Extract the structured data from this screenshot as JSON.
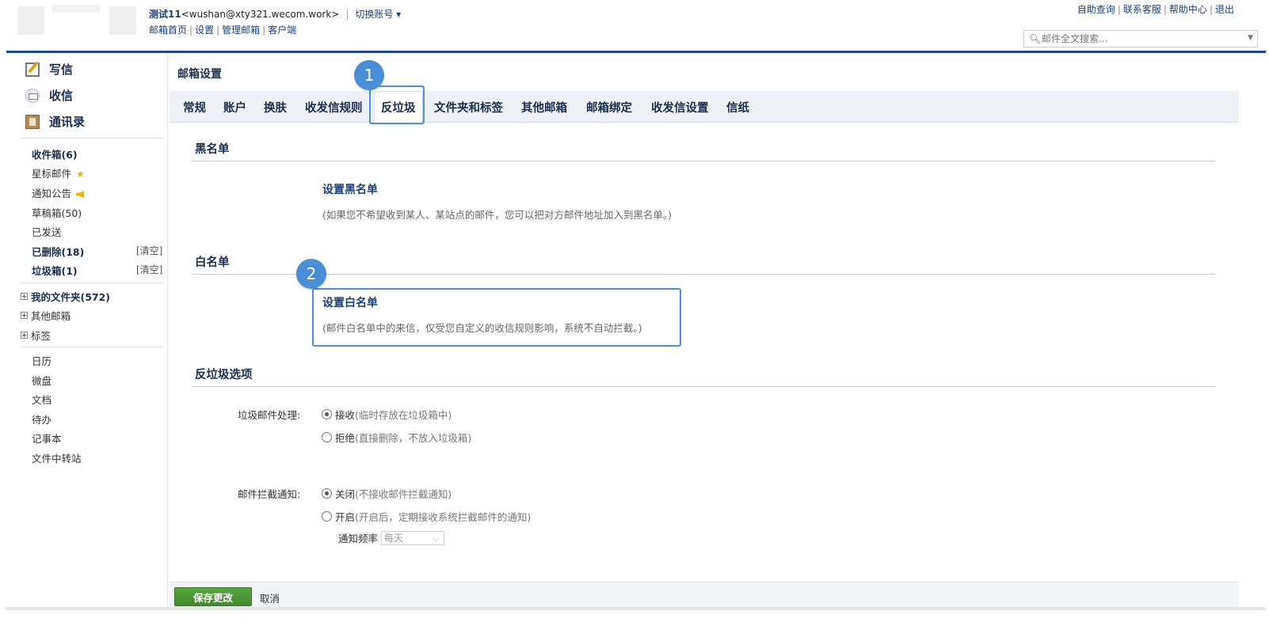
{
  "header": {
    "user_name": "测试11",
    "user_email": "<wushan@xty321.wecom.work>",
    "separator": "|",
    "switch_account": "切换账号",
    "links": [
      "邮箱首页",
      "设置",
      "管理邮箱",
      "客户端"
    ],
    "right_links": [
      "自助查询",
      "联系客服",
      "帮助中心",
      "退出"
    ],
    "search_placeholder": "邮件全文搜索..."
  },
  "sidebar": {
    "compose": "写信",
    "receive": "收信",
    "contacts": "通讯录",
    "folders": [
      {
        "label": "收件箱(6)"
      },
      {
        "label": "星标邮件"
      },
      {
        "label": "通知公告"
      },
      {
        "label": "草稿箱(50)"
      },
      {
        "label": "已发送"
      },
      {
        "label": "已删除(18)",
        "action": "[清空]"
      },
      {
        "label": "垃圾箱(1)",
        "action": "[清空]"
      }
    ],
    "tree": [
      "我的文件夹(572)",
      "其他邮箱",
      "标签"
    ],
    "apps": [
      "日历",
      "微盘",
      "文档",
      "待办",
      "记事本",
      "文件中转站"
    ]
  },
  "main": {
    "title": "邮箱设置",
    "tabs": [
      "常规",
      "账户",
      "换肤",
      "收发信规则",
      "反垃圾",
      "文件夹和标签",
      "其他邮箱",
      "邮箱绑定",
      "收发信设置",
      "信纸"
    ],
    "active_tab": "反垃圾",
    "blacklist": {
      "title": "黑名单",
      "link": "设置黑名单",
      "note": "(如果您不希望收到某人、某站点的邮件，您可以把对方邮件地址加入到黑名单。)"
    },
    "whitelist": {
      "title": "白名单",
      "link": "设置白名单",
      "note": "(邮件白名单中的来信，仅受您自定义的收信规则影响，系统不自动拦截。)"
    },
    "antispam": {
      "title": "反垃圾选项",
      "spam_label": "垃圾邮件处理:",
      "spam_options": [
        {
          "label": "接收",
          "hint": "(临时存放在垃圾箱中)",
          "checked": true
        },
        {
          "label": "拒绝",
          "hint": "(直接删除，不放入垃圾箱)",
          "checked": false
        }
      ],
      "notify_label": "邮件拦截通知:",
      "notify_options": [
        {
          "label": "关闭",
          "hint": "(不接收邮件拦截通知)",
          "checked": true
        },
        {
          "label": "开启",
          "hint": "(开启后，定期接收系统拦截邮件的通知)",
          "checked": false
        }
      ],
      "freq_label": "通知频率",
      "freq_value": "每天"
    }
  },
  "footer": {
    "save": "保存更改",
    "cancel": "取消"
  },
  "annotations": {
    "badge_1": "1",
    "badge_2": "2"
  },
  "colors": {
    "accent_blue": "#1d4a8a",
    "highlight": "#4a90e2",
    "save_green": "#4a9a36"
  }
}
